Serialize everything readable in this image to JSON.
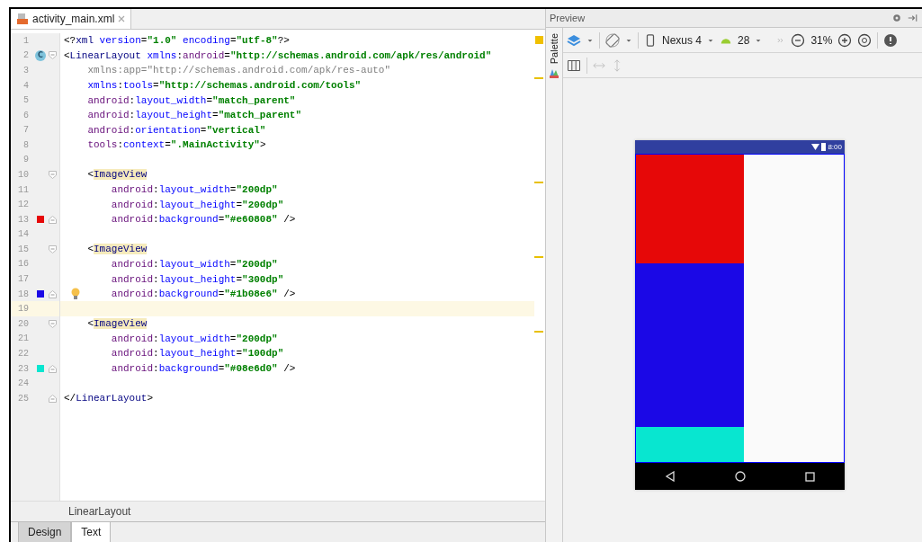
{
  "editor": {
    "tab": {
      "label": "activity_main.xml"
    },
    "lines": [
      {
        "number": "1",
        "kind": "top",
        "segments": [
          {
            "kind": "p",
            "text": "<?"
          },
          {
            "kind": "tag",
            "text": "xml"
          },
          {
            "kind": "attr",
            "text": " version"
          },
          {
            "kind": "p",
            "text": "="
          },
          {
            "kind": "val",
            "text": "\"1.0\""
          },
          {
            "kind": "attr",
            "text": " encoding"
          },
          {
            "kind": "p",
            "text": "="
          },
          {
            "kind": "val",
            "text": "\"utf-8\""
          },
          {
            "kind": "p",
            "text": "?>"
          }
        ]
      },
      {
        "number": "2",
        "kind": "top",
        "marker": {
          "kind": "class",
          "text": "C"
        },
        "fold_open": true,
        "segments": [
          {
            "kind": "p",
            "text": "<"
          },
          {
            "kind": "tag",
            "text": "LinearLayout"
          },
          {
            "kind": "attr",
            "text": " xmlns"
          },
          {
            "kind": "p",
            "text": ":"
          },
          {
            "kind": "ns",
            "text": "android"
          },
          {
            "kind": "p",
            "text": "="
          },
          {
            "kind": "val",
            "text": "\"http://schemas.android.com/apk/res/android\""
          }
        ]
      },
      {
        "number": "3",
        "kind": "attr",
        "segments": [
          {
            "kind": "dim",
            "text": "xmlns:app=\"http://schemas.android.com/apk/res-auto\""
          }
        ]
      },
      {
        "number": "4",
        "kind": "attr",
        "segments": [
          {
            "kind": "attr",
            "text": "xmlns"
          },
          {
            "kind": "p",
            "text": ":"
          },
          {
            "kind": "attr",
            "text": "tools"
          },
          {
            "kind": "p",
            "text": "="
          },
          {
            "kind": "val",
            "text": "\"http://schemas.android.com/tools\""
          }
        ]
      },
      {
        "number": "5",
        "kind": "attr",
        "segments": [
          {
            "kind": "ns",
            "text": "android"
          },
          {
            "kind": "p",
            "text": ":"
          },
          {
            "kind": "attr",
            "text": "layout_width"
          },
          {
            "kind": "p",
            "text": "="
          },
          {
            "kind": "val",
            "text": "\"match_parent\""
          }
        ]
      },
      {
        "number": "6",
        "kind": "attr",
        "segments": [
          {
            "kind": "ns",
            "text": "android"
          },
          {
            "kind": "p",
            "text": ":"
          },
          {
            "kind": "attr",
            "text": "layout_height"
          },
          {
            "kind": "p",
            "text": "="
          },
          {
            "kind": "val",
            "text": "\"match_parent\""
          }
        ]
      },
      {
        "number": "7",
        "kind": "attr",
        "segments": [
          {
            "kind": "ns",
            "text": "android"
          },
          {
            "kind": "p",
            "text": ":"
          },
          {
            "kind": "attr",
            "text": "orientation"
          },
          {
            "kind": "p",
            "text": "="
          },
          {
            "kind": "val",
            "text": "\"vertical\""
          }
        ]
      },
      {
        "number": "8",
        "kind": "attr",
        "segments": [
          {
            "kind": "ns",
            "text": "tools"
          },
          {
            "kind": "p",
            "text": ":"
          },
          {
            "kind": "attr",
            "text": "context"
          },
          {
            "kind": "p",
            "text": "="
          },
          {
            "kind": "val",
            "text": "\".MainActivity\""
          },
          {
            "kind": "p",
            "text": ">"
          }
        ]
      },
      {
        "number": "9",
        "kind": "top"
      },
      {
        "number": "10",
        "kind": "child",
        "fold_open": true,
        "segments": [
          {
            "kind": "p",
            "text": "<"
          },
          {
            "kind": "hl",
            "text": "ImageView"
          }
        ]
      },
      {
        "number": "11",
        "kind": "child-attr",
        "segments": [
          {
            "kind": "ns",
            "text": "android"
          },
          {
            "kind": "p",
            "text": ":"
          },
          {
            "kind": "attr",
            "text": "layout_width"
          },
          {
            "kind": "p",
            "text": "="
          },
          {
            "kind": "val",
            "text": "\"200dp\""
          }
        ]
      },
      {
        "number": "12",
        "kind": "child-attr",
        "segments": [
          {
            "kind": "ns",
            "text": "android"
          },
          {
            "kind": "p",
            "text": ":"
          },
          {
            "kind": "attr",
            "text": "layout_height"
          },
          {
            "kind": "p",
            "text": "="
          },
          {
            "kind": "val",
            "text": "\"200dp\""
          }
        ]
      },
      {
        "number": "13",
        "kind": "child-attr",
        "marker": {
          "kind": "color",
          "color": "#e60808"
        },
        "fold_close": true,
        "segments": [
          {
            "kind": "ns",
            "text": "android"
          },
          {
            "kind": "p",
            "text": ":"
          },
          {
            "kind": "attr",
            "text": "background"
          },
          {
            "kind": "p",
            "text": "="
          },
          {
            "kind": "val",
            "text": "\"#e60808\""
          },
          {
            "kind": "p",
            "text": " />"
          }
        ]
      },
      {
        "number": "14",
        "kind": "top"
      },
      {
        "number": "15",
        "kind": "child",
        "fold_open": true,
        "segments": [
          {
            "kind": "p",
            "text": "<"
          },
          {
            "kind": "hl",
            "text": "ImageView"
          }
        ]
      },
      {
        "number": "16",
        "kind": "child-attr",
        "segments": [
          {
            "kind": "ns",
            "text": "android"
          },
          {
            "kind": "p",
            "text": ":"
          },
          {
            "kind": "attr",
            "text": "layout_width"
          },
          {
            "kind": "p",
            "text": "="
          },
          {
            "kind": "val",
            "text": "\"200dp\""
          }
        ]
      },
      {
        "number": "17",
        "kind": "child-attr",
        "segments": [
          {
            "kind": "ns",
            "text": "android"
          },
          {
            "kind": "p",
            "text": ":"
          },
          {
            "kind": "attr",
            "text": "layout_height"
          },
          {
            "kind": "p",
            "text": "="
          },
          {
            "kind": "val",
            "text": "\"300dp\""
          }
        ]
      },
      {
        "number": "18",
        "kind": "child-attr",
        "marker": {
          "kind": "color",
          "color": "#1b08e6"
        },
        "fold_close": true,
        "bulb": true,
        "segments": [
          {
            "kind": "ns",
            "text": "android"
          },
          {
            "kind": "p",
            "text": ":"
          },
          {
            "kind": "attr",
            "text": "background"
          },
          {
            "kind": "p",
            "text": "="
          },
          {
            "kind": "val",
            "text": "\"#1b08e6\""
          },
          {
            "kind": "p",
            "text": " />"
          }
        ]
      },
      {
        "number": "19",
        "kind": "top",
        "current": true
      },
      {
        "number": "20",
        "kind": "child",
        "fold_open": true,
        "segments": [
          {
            "kind": "p",
            "text": "<"
          },
          {
            "kind": "hl",
            "text": "ImageView"
          }
        ]
      },
      {
        "number": "21",
        "kind": "child-attr",
        "segments": [
          {
            "kind": "ns",
            "text": "android"
          },
          {
            "kind": "p",
            "text": ":"
          },
          {
            "kind": "attr",
            "text": "layout_width"
          },
          {
            "kind": "p",
            "text": "="
          },
          {
            "kind": "val",
            "text": "\"200dp\""
          }
        ]
      },
      {
        "number": "22",
        "kind": "child-attr",
        "segments": [
          {
            "kind": "ns",
            "text": "android"
          },
          {
            "kind": "p",
            "text": ":"
          },
          {
            "kind": "attr",
            "text": "layout_height"
          },
          {
            "kind": "p",
            "text": "="
          },
          {
            "kind": "val",
            "text": "\"100dp\""
          }
        ]
      },
      {
        "number": "23",
        "kind": "child-attr",
        "marker": {
          "kind": "color",
          "color": "#08e6d0"
        },
        "fold_close": true,
        "segments": [
          {
            "kind": "ns",
            "text": "android"
          },
          {
            "kind": "p",
            "text": ":"
          },
          {
            "kind": "attr",
            "text": "background"
          },
          {
            "kind": "p",
            "text": "="
          },
          {
            "kind": "val",
            "text": "\"#08e6d0\""
          },
          {
            "kind": "p",
            "text": " />"
          }
        ]
      },
      {
        "number": "24",
        "kind": "top"
      },
      {
        "number": "25",
        "kind": "top",
        "fold_close": true,
        "segments": [
          {
            "kind": "p",
            "text": "</"
          },
          {
            "kind": "tag",
            "text": "LinearLayout"
          },
          {
            "kind": "p",
            "text": ">"
          }
        ]
      }
    ],
    "breadcrumb": "LinearLayout"
  },
  "bottom_tabs": [
    {
      "label": "Design",
      "selected": false
    },
    {
      "label": "Text",
      "selected": true
    }
  ],
  "preview": {
    "title": "Preview",
    "palette_label": "Palette",
    "device": "Nexus 4",
    "api": "28",
    "zoom": "31%",
    "status_time": "8:00",
    "views": [
      {
        "color": "#e60808"
      },
      {
        "color": "#1b08e6"
      },
      {
        "color": "#08e6d0"
      }
    ]
  }
}
